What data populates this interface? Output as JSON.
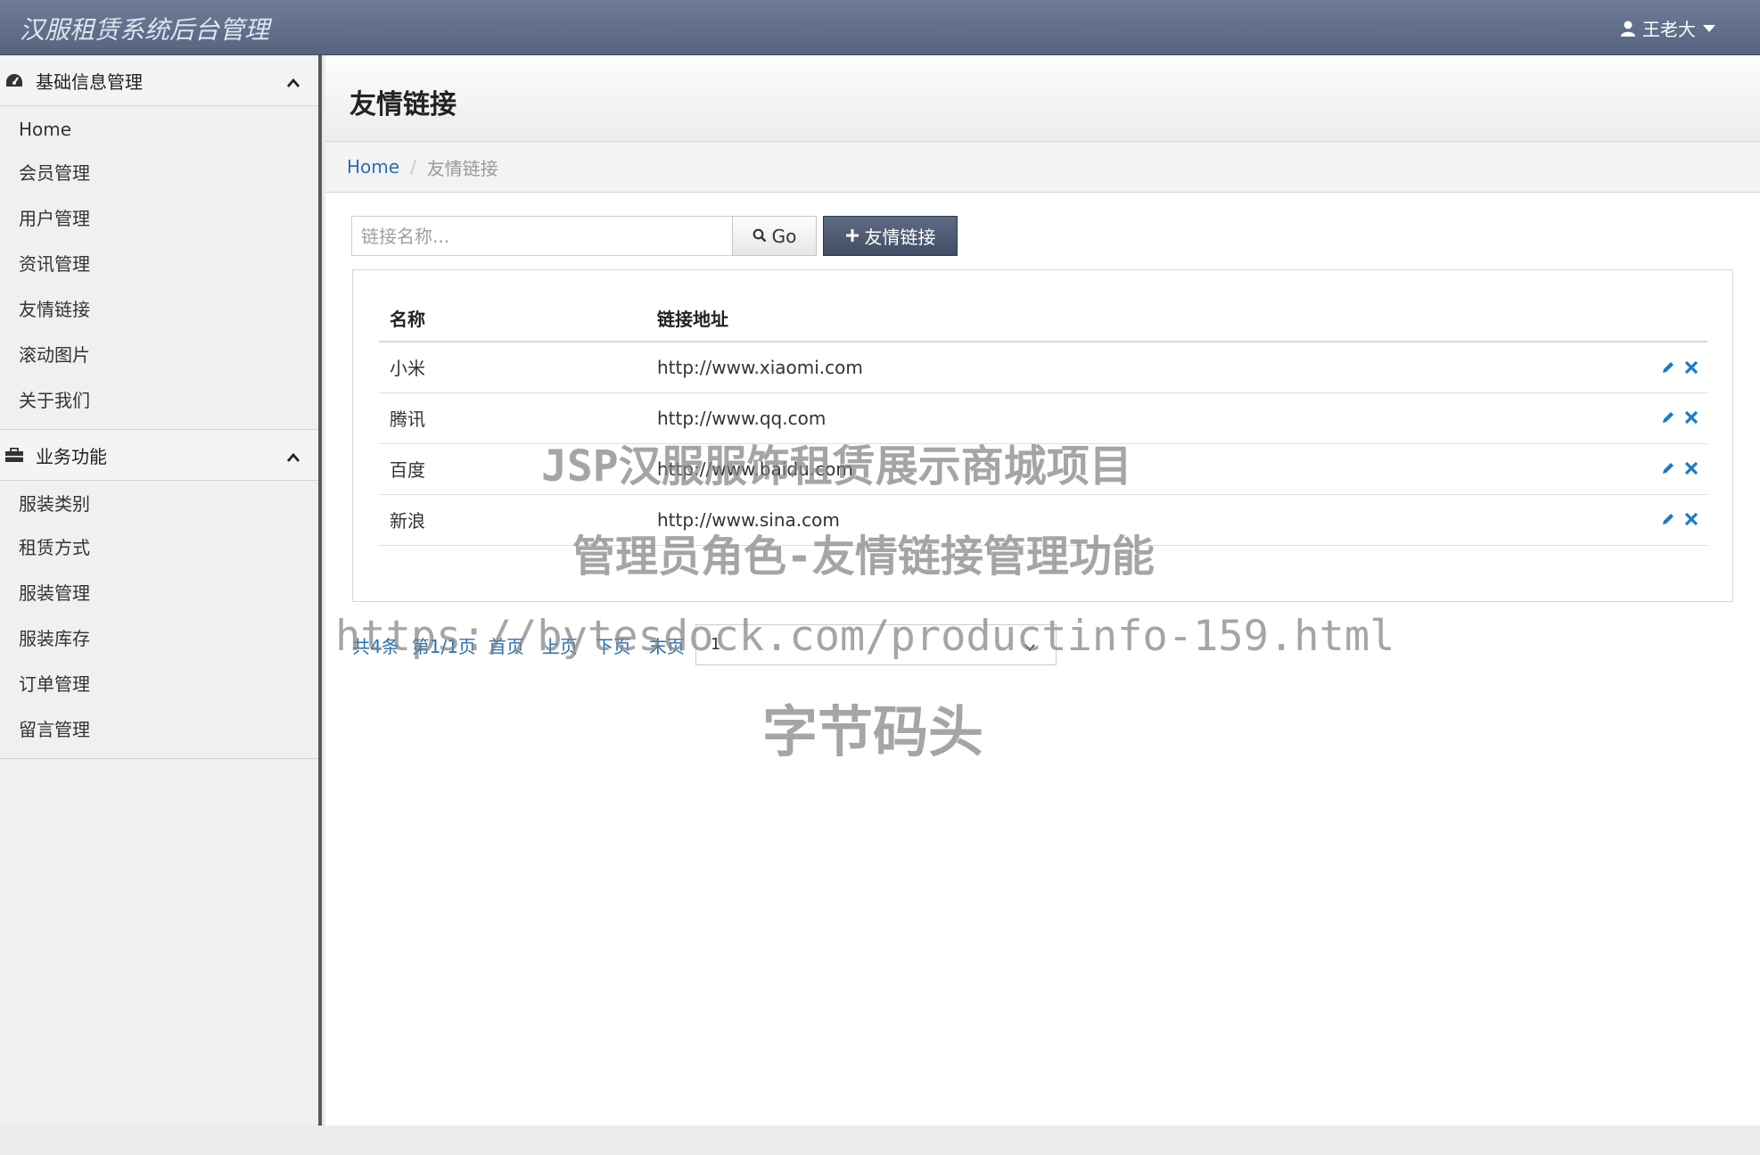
{
  "app": {
    "title": "汉服租赁系统后台管理",
    "user": "王老大"
  },
  "sidebar": {
    "sections": [
      {
        "title": "基础信息管理",
        "icon": "dashboard-icon",
        "items": [
          "Home",
          "会员管理",
          "用户管理",
          "资讯管理",
          "友情链接",
          "滚动图片",
          "关于我们"
        ]
      },
      {
        "title": "业务功能",
        "icon": "briefcase-icon",
        "items": [
          "服装类别",
          "租赁方式",
          "服装管理",
          "服装库存",
          "订单管理",
          "留言管理"
        ]
      }
    ]
  },
  "page": {
    "title": "友情链接",
    "breadcrumb": {
      "home": "Home",
      "current": "友情链接"
    }
  },
  "toolbar": {
    "search_placeholder": "链接名称...",
    "go_label": "Go",
    "add_label": "友情链接"
  },
  "table": {
    "headers": [
      "名称",
      "链接地址"
    ],
    "rows": [
      {
        "name": "小米",
        "url": "http://www.xiaomi.com"
      },
      {
        "name": "腾讯",
        "url": "http://www.qq.com"
      },
      {
        "name": "百度",
        "url": "http://www.baidu.com"
      },
      {
        "name": "新浪",
        "url": "http://www.sina.com"
      }
    ]
  },
  "pager": {
    "summary": "共4条",
    "page_info": "第1/1页",
    "first": "首页",
    "prev": "上页",
    "next": "下页",
    "last": "末页",
    "selected": "1"
  },
  "watermark": {
    "line1": "JSP汉服服饰租赁展示商城项目",
    "line2": "管理员角色-友情链接管理功能",
    "line3": "https://bytesdock.com/productinfo-159.html",
    "line4": "字节码头"
  },
  "colors": {
    "navbar": "#5f6d8a",
    "primary_button": "#4a566d",
    "link": "#2a6fb0",
    "action_icon": "#1a7bc4"
  }
}
